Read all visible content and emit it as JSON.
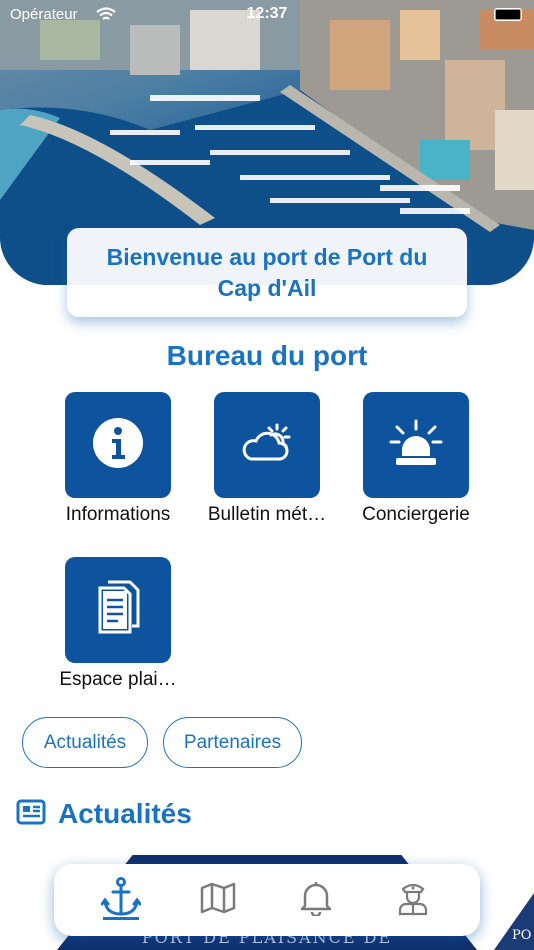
{
  "status_bar": {
    "carrier": "Opérateur",
    "time": "12:37"
  },
  "hero": {
    "welcome_title": "Bienvenue au port de Port du Cap d'Ail"
  },
  "services": {
    "section_title": "Bureau du port",
    "tiles": [
      {
        "label": "Informations",
        "icon": "info-icon"
      },
      {
        "label": "Bulletin mét…",
        "icon": "weather-icon"
      },
      {
        "label": "Conciergerie",
        "icon": "alarm-light-icon"
      },
      {
        "label": "Espace plai…",
        "icon": "documents-icon"
      }
    ]
  },
  "filters": {
    "pills": [
      "Actualités",
      "Partenaires"
    ]
  },
  "news": {
    "title": "Actualités",
    "icon": "newspaper-icon",
    "banner_text": "PORT DE PLAISANCE DE",
    "corner_text": "PO"
  },
  "tab_bar": {
    "tabs": [
      {
        "icon": "anchor-icon",
        "selected": true
      },
      {
        "icon": "map-icon",
        "selected": false
      },
      {
        "icon": "bell-icon",
        "selected": false
      },
      {
        "icon": "captain-icon",
        "selected": false
      }
    ]
  },
  "colors": {
    "accent": "#1a73c2",
    "tile_background": "#0d539e",
    "icon_grey": "#7a7a7a"
  }
}
